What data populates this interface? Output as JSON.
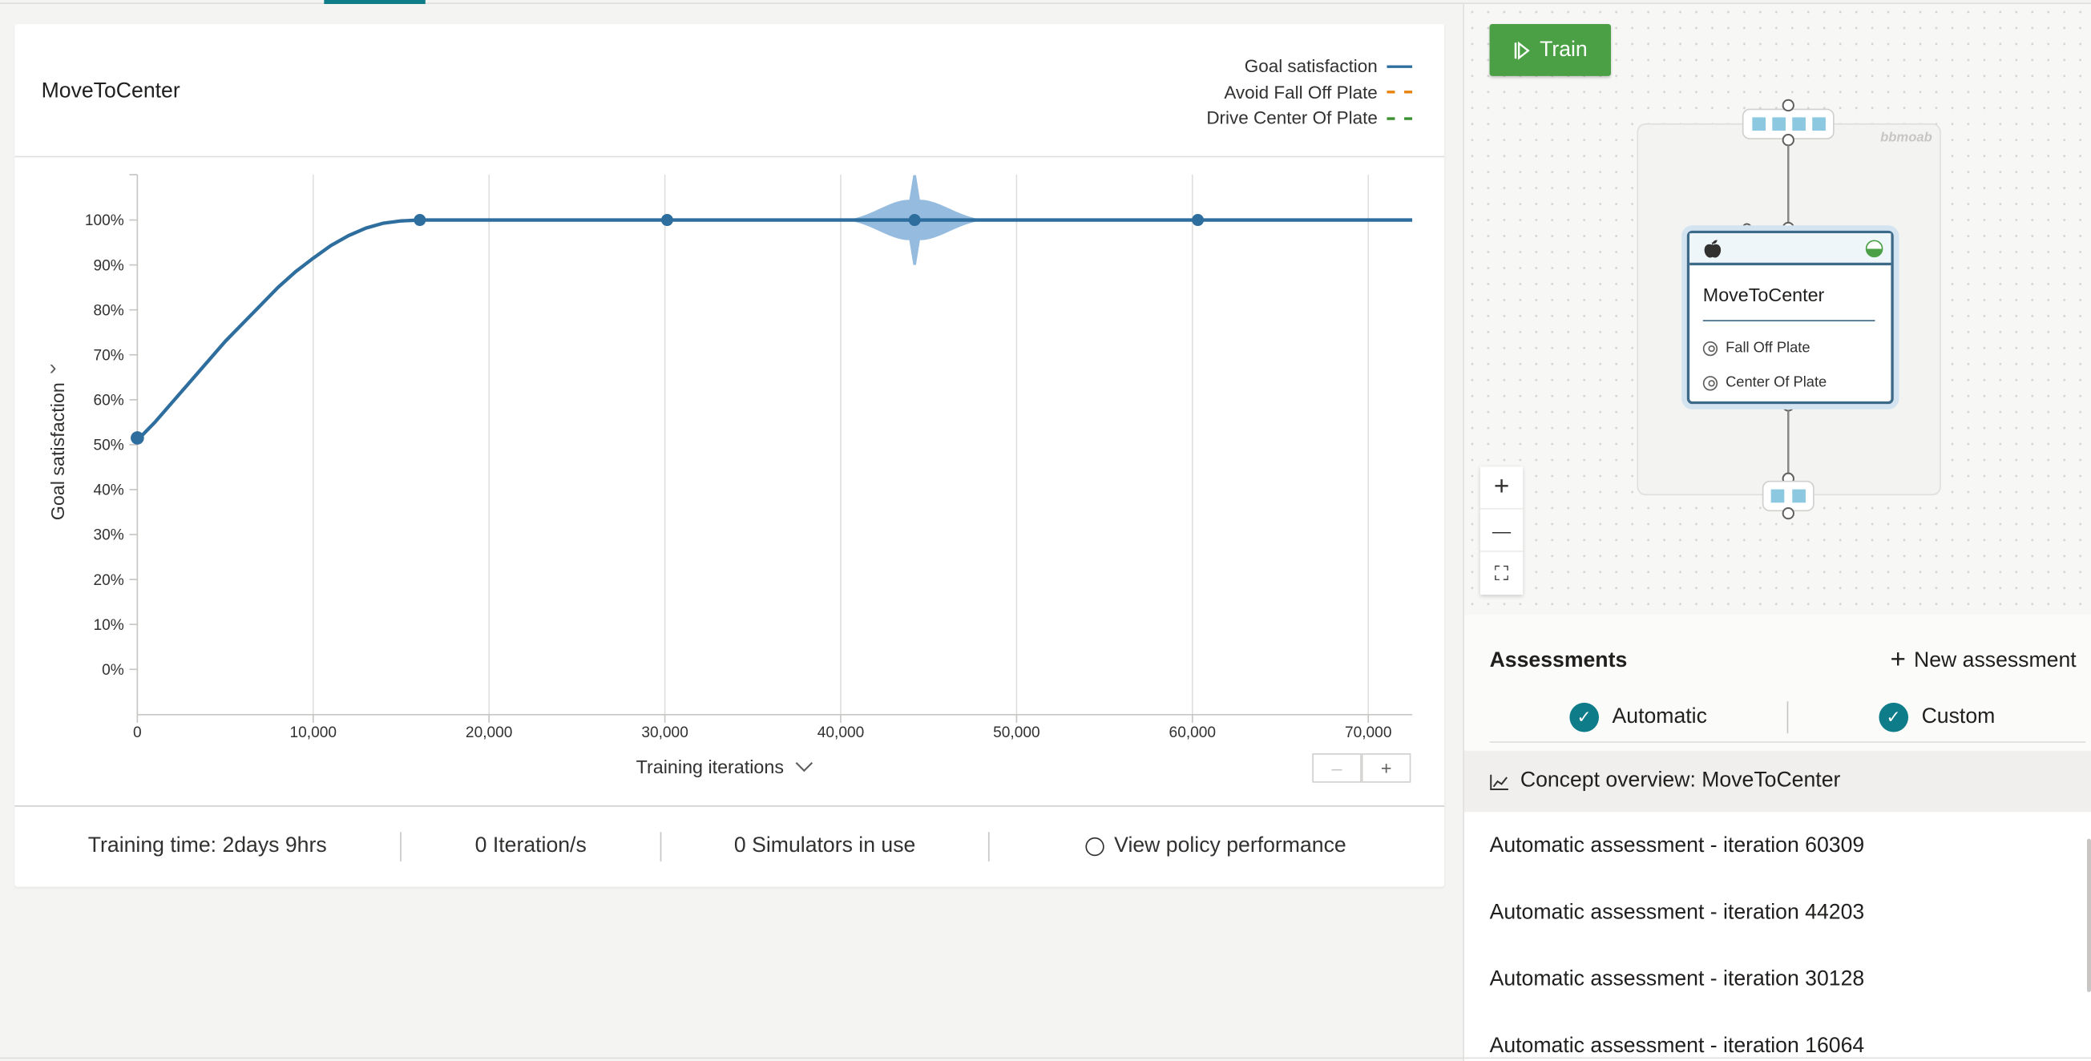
{
  "chart_panel": {
    "title": "MoveToCenter",
    "legend": [
      {
        "label": "Goal satisfaction",
        "color": "#2e6e9e",
        "style": "solid"
      },
      {
        "label": "Avoid Fall Off Plate",
        "color": "#e8820c",
        "style": "dashed"
      },
      {
        "label": "Drive Center Of Plate",
        "color": "#3a8f2e",
        "style": "dashed"
      }
    ],
    "xlabel": "Training iterations",
    "zoom_out": "–",
    "zoom_in": "+",
    "stats": {
      "training_time": "Training time: 2days 9hrs",
      "iterations": "0 Iteration/s",
      "simulators": "0 Simulators in use",
      "view_policy": "View policy performance"
    }
  },
  "chart_data": {
    "type": "line",
    "ylabel": "Goal satisfaction",
    "xlabel": "Training iterations",
    "ylim": [
      0,
      100
    ],
    "xlim": [
      0,
      72500
    ],
    "ytick_labels": [
      "0%",
      "10%",
      "20%",
      "30%",
      "40%",
      "50%",
      "60%",
      "70%",
      "80%",
      "90%",
      "100%"
    ],
    "yticks": [
      0,
      10,
      20,
      30,
      40,
      50,
      60,
      70,
      80,
      90,
      100
    ],
    "xtick_labels": [
      "0",
      "10,000",
      "20,000",
      "30,000",
      "40,000",
      "50,000",
      "60,000",
      "70,000"
    ],
    "xticks": [
      0,
      10000,
      20000,
      30000,
      40000,
      50000,
      60000,
      70000
    ],
    "series": [
      {
        "name": "Goal satisfaction",
        "color": "#2e6e9e",
        "x": [
          0,
          1000,
          2000,
          3000,
          4000,
          5000,
          6000,
          7000,
          8000,
          9000,
          10000,
          11000,
          12000,
          13000,
          14000,
          15000,
          16064,
          20000,
          30128,
          40000,
          44203,
          50000,
          60309,
          72500
        ],
        "y": [
          51,
          55,
          59.5,
          64,
          68.5,
          73,
          77,
          81,
          85,
          88.5,
          91.5,
          94.3,
          96.5,
          98.2,
          99.3,
          99.8,
          100,
          100,
          100,
          100,
          100,
          100,
          100,
          100
        ],
        "markers_x": [
          0,
          16064,
          30128,
          44203,
          60309
        ],
        "markers_y": [
          51.5,
          100,
          100,
          100,
          100
        ]
      }
    ],
    "variance_band": {
      "x_center": 44203,
      "x_start": 40000,
      "x_end": 48500,
      "half_width_y": 4.5,
      "spike_y": 10
    }
  },
  "graph_panel": {
    "train_label": "Train",
    "brain_name": "bbmoab",
    "concept": {
      "name": "MoveToCenter",
      "goals": [
        "Fall Off Plate",
        "Center Of Plate"
      ]
    },
    "zoom_in_icon": "+",
    "zoom_out_icon": "—",
    "fit_icon": "⛶"
  },
  "assessments": {
    "title": "Assessments",
    "new_label": "New assessment",
    "tabs": [
      "Automatic",
      "Custom"
    ],
    "overview": "Concept overview: MoveToCenter",
    "items": [
      "Automatic assessment - iteration 60309",
      "Automatic assessment - iteration 44203",
      "Automatic assessment - iteration 30128",
      "Automatic assessment - iteration 16064"
    ]
  }
}
